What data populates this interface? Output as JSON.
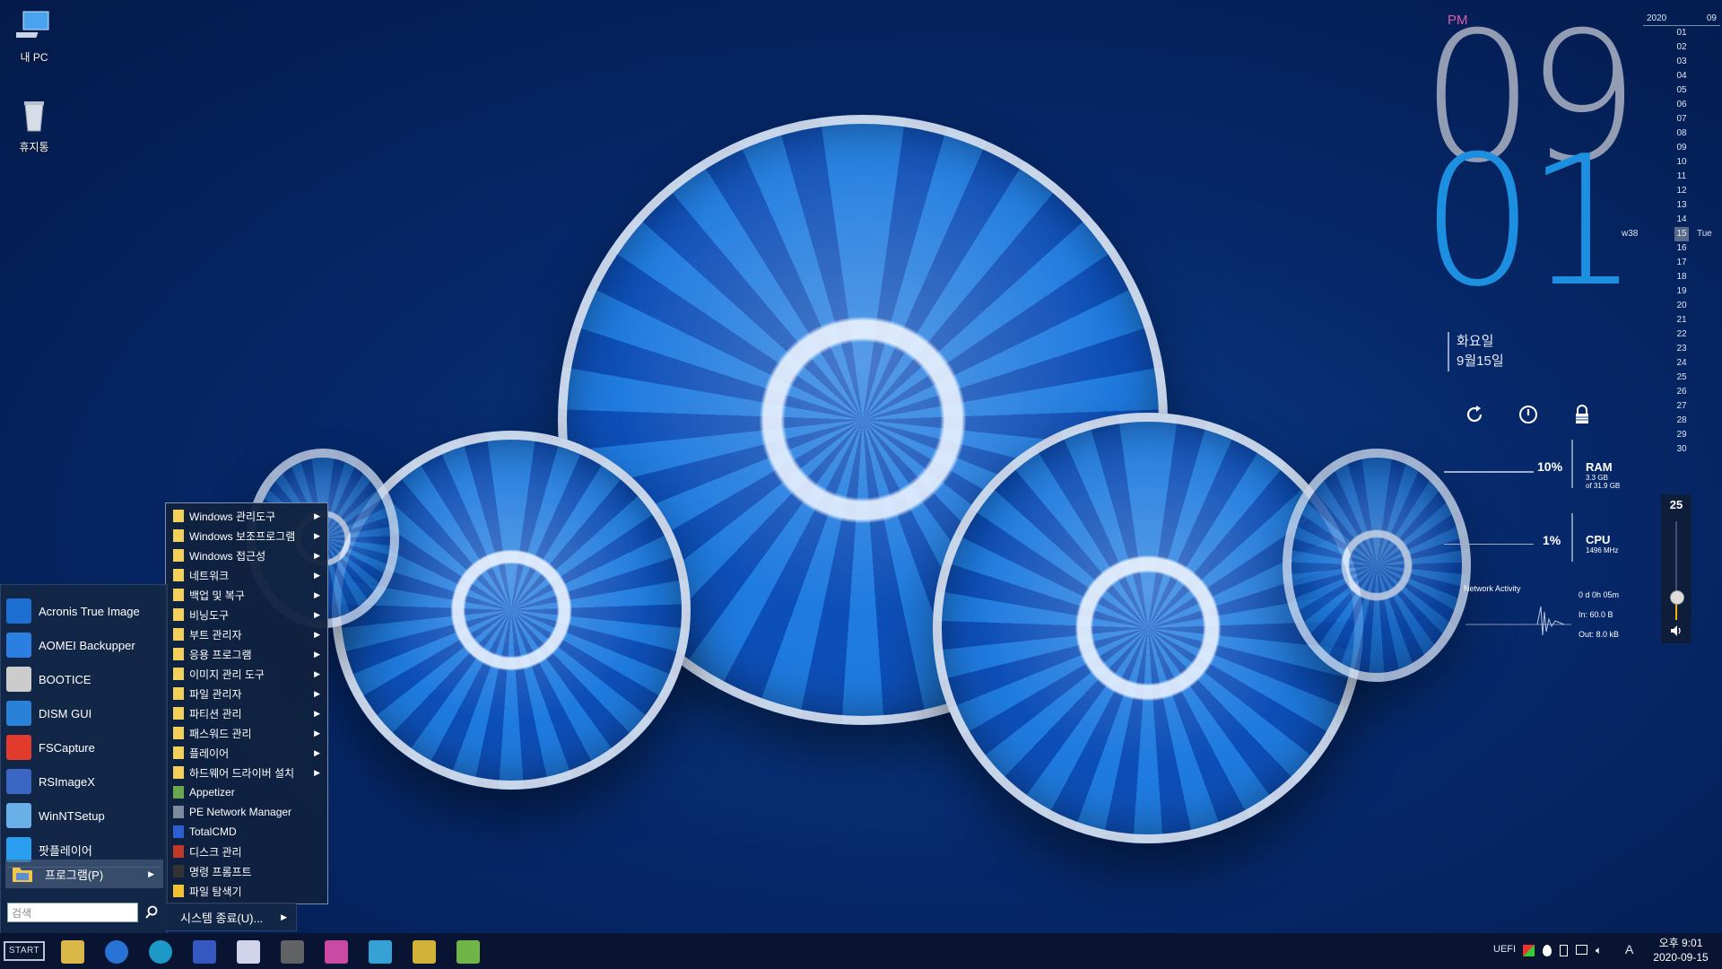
{
  "desktop": {
    "icons": [
      {
        "label": "내 PC",
        "icon": "computer-icon"
      },
      {
        "label": "휴지통",
        "icon": "recycle-bin-icon"
      }
    ]
  },
  "clock": {
    "ampm": "PM",
    "hour": "09",
    "minute": "01",
    "weekday": "화요일",
    "date": "9월15일"
  },
  "calendar": {
    "year": "2020",
    "month": "09",
    "days": [
      "01",
      "02",
      "03",
      "04",
      "05",
      "06",
      "07",
      "08",
      "09",
      "10",
      "11",
      "12",
      "13",
      "14",
      "15",
      "16",
      "17",
      "18",
      "19",
      "20",
      "21",
      "22",
      "23",
      "24",
      "25",
      "26",
      "27",
      "28",
      "29",
      "30"
    ],
    "today": "15",
    "week_label": "w38",
    "weekday_label": "Tue"
  },
  "monitor": {
    "ram": {
      "percent": "10%",
      "label": "RAM",
      "used": "3.3 GB",
      "total": "of 31.9 GB"
    },
    "cpu": {
      "percent": "1%",
      "label": "CPU",
      "freq": "1496 MHz"
    },
    "network": {
      "label": "Network Activity",
      "uptime": "0 d 0h 05m",
      "in": "In: 60.0 B",
      "out": "Out: 8.0 kB"
    }
  },
  "volume": {
    "value": "25",
    "level": 0.25
  },
  "start_menu": {
    "items": [
      {
        "label": "Acronis True Image",
        "icon": "acronis-icon"
      },
      {
        "label": "AOMEI Backupper",
        "icon": "aomei-icon"
      },
      {
        "label": "BOOTICE",
        "icon": "bootice-icon"
      },
      {
        "label": "DISM GUI",
        "icon": "dism-icon"
      },
      {
        "label": "FSCapture",
        "icon": "fscapture-icon"
      },
      {
        "label": "RSImageX",
        "icon": "rsimagex-icon"
      },
      {
        "label": "WinNTSetup",
        "icon": "winntsetup-icon"
      },
      {
        "label": "팟플레이어",
        "icon": "potplayer-icon"
      }
    ],
    "programs_label": "프로그램(P)",
    "search_placeholder": "검색",
    "shutdown_label": "시스템 종료(U)..."
  },
  "submenu": {
    "folders": [
      "Windows 관리도구",
      "Windows 보조프로그램",
      "Windows 접근성",
      "네트워크",
      "백업 및 복구",
      "비닝도구",
      "부트 관리자",
      "응용 프로그램",
      "이미지 관리 도구",
      "파일 관리자",
      "파티션 관리",
      "패스워드 관리",
      "플레이어",
      "하드웨어 드라이버 설치"
    ],
    "apps": [
      {
        "label": "Appetizer",
        "icon": "appetizer-icon"
      },
      {
        "label": "PE Network Manager",
        "icon": "network-manager-icon"
      },
      {
        "label": "TotalCMD",
        "icon": "totalcmd-icon"
      },
      {
        "label": "디스크 관리",
        "icon": "disk-management-icon"
      },
      {
        "label": "명령 프롬프트",
        "icon": "command-prompt-icon"
      },
      {
        "label": "파일 탐색기",
        "icon": "file-explorer-icon"
      }
    ]
  },
  "taskbar": {
    "start_label": "START",
    "apps": [
      "file-explorer-icon",
      "internet-explorer-icon",
      "edge-icon",
      "save-icon",
      "editor-icon",
      "tool-icon",
      "color-icon",
      "monitor-icon",
      "r-icon",
      "leaf-icon"
    ],
    "tray_text": "UEFI",
    "ime": "A",
    "time": "오후 9:01",
    "date": "2020-09-15",
    "colors": {
      "accent": "#1d8fe0",
      "taskbar": "#08142f",
      "ampm": "#e05bb0"
    }
  }
}
